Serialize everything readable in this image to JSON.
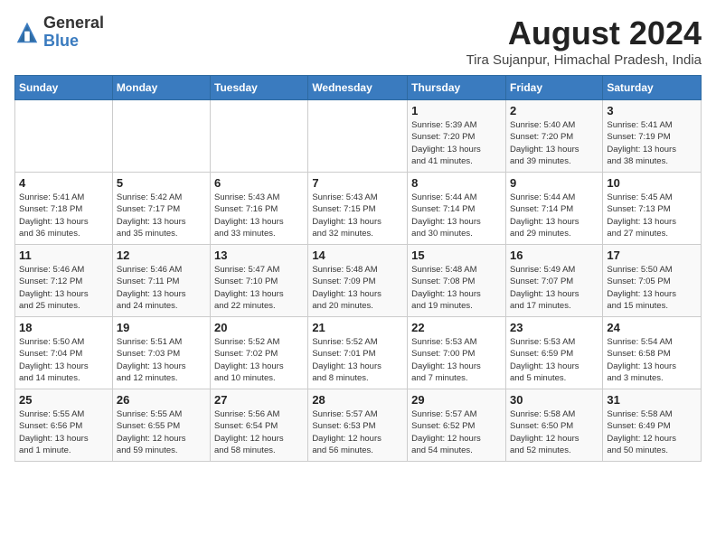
{
  "header": {
    "logo_general": "General",
    "logo_blue": "Blue",
    "month_year": "August 2024",
    "location": "Tira Sujanpur, Himachal Pradesh, India"
  },
  "days_of_week": [
    "Sunday",
    "Monday",
    "Tuesday",
    "Wednesday",
    "Thursday",
    "Friday",
    "Saturday"
  ],
  "weeks": [
    [
      {
        "day": "",
        "info": ""
      },
      {
        "day": "",
        "info": ""
      },
      {
        "day": "",
        "info": ""
      },
      {
        "day": "",
        "info": ""
      },
      {
        "day": "1",
        "info": "Sunrise: 5:39 AM\nSunset: 7:20 PM\nDaylight: 13 hours\nand 41 minutes."
      },
      {
        "day": "2",
        "info": "Sunrise: 5:40 AM\nSunset: 7:20 PM\nDaylight: 13 hours\nand 39 minutes."
      },
      {
        "day": "3",
        "info": "Sunrise: 5:41 AM\nSunset: 7:19 PM\nDaylight: 13 hours\nand 38 minutes."
      }
    ],
    [
      {
        "day": "4",
        "info": "Sunrise: 5:41 AM\nSunset: 7:18 PM\nDaylight: 13 hours\nand 36 minutes."
      },
      {
        "day": "5",
        "info": "Sunrise: 5:42 AM\nSunset: 7:17 PM\nDaylight: 13 hours\nand 35 minutes."
      },
      {
        "day": "6",
        "info": "Sunrise: 5:43 AM\nSunset: 7:16 PM\nDaylight: 13 hours\nand 33 minutes."
      },
      {
        "day": "7",
        "info": "Sunrise: 5:43 AM\nSunset: 7:15 PM\nDaylight: 13 hours\nand 32 minutes."
      },
      {
        "day": "8",
        "info": "Sunrise: 5:44 AM\nSunset: 7:14 PM\nDaylight: 13 hours\nand 30 minutes."
      },
      {
        "day": "9",
        "info": "Sunrise: 5:44 AM\nSunset: 7:14 PM\nDaylight: 13 hours\nand 29 minutes."
      },
      {
        "day": "10",
        "info": "Sunrise: 5:45 AM\nSunset: 7:13 PM\nDaylight: 13 hours\nand 27 minutes."
      }
    ],
    [
      {
        "day": "11",
        "info": "Sunrise: 5:46 AM\nSunset: 7:12 PM\nDaylight: 13 hours\nand 25 minutes."
      },
      {
        "day": "12",
        "info": "Sunrise: 5:46 AM\nSunset: 7:11 PM\nDaylight: 13 hours\nand 24 minutes."
      },
      {
        "day": "13",
        "info": "Sunrise: 5:47 AM\nSunset: 7:10 PM\nDaylight: 13 hours\nand 22 minutes."
      },
      {
        "day": "14",
        "info": "Sunrise: 5:48 AM\nSunset: 7:09 PM\nDaylight: 13 hours\nand 20 minutes."
      },
      {
        "day": "15",
        "info": "Sunrise: 5:48 AM\nSunset: 7:08 PM\nDaylight: 13 hours\nand 19 minutes."
      },
      {
        "day": "16",
        "info": "Sunrise: 5:49 AM\nSunset: 7:07 PM\nDaylight: 13 hours\nand 17 minutes."
      },
      {
        "day": "17",
        "info": "Sunrise: 5:50 AM\nSunset: 7:05 PM\nDaylight: 13 hours\nand 15 minutes."
      }
    ],
    [
      {
        "day": "18",
        "info": "Sunrise: 5:50 AM\nSunset: 7:04 PM\nDaylight: 13 hours\nand 14 minutes."
      },
      {
        "day": "19",
        "info": "Sunrise: 5:51 AM\nSunset: 7:03 PM\nDaylight: 13 hours\nand 12 minutes."
      },
      {
        "day": "20",
        "info": "Sunrise: 5:52 AM\nSunset: 7:02 PM\nDaylight: 13 hours\nand 10 minutes."
      },
      {
        "day": "21",
        "info": "Sunrise: 5:52 AM\nSunset: 7:01 PM\nDaylight: 13 hours\nand 8 minutes."
      },
      {
        "day": "22",
        "info": "Sunrise: 5:53 AM\nSunset: 7:00 PM\nDaylight: 13 hours\nand 7 minutes."
      },
      {
        "day": "23",
        "info": "Sunrise: 5:53 AM\nSunset: 6:59 PM\nDaylight: 13 hours\nand 5 minutes."
      },
      {
        "day": "24",
        "info": "Sunrise: 5:54 AM\nSunset: 6:58 PM\nDaylight: 13 hours\nand 3 minutes."
      }
    ],
    [
      {
        "day": "25",
        "info": "Sunrise: 5:55 AM\nSunset: 6:56 PM\nDaylight: 13 hours\nand 1 minute."
      },
      {
        "day": "26",
        "info": "Sunrise: 5:55 AM\nSunset: 6:55 PM\nDaylight: 12 hours\nand 59 minutes."
      },
      {
        "day": "27",
        "info": "Sunrise: 5:56 AM\nSunset: 6:54 PM\nDaylight: 12 hours\nand 58 minutes."
      },
      {
        "day": "28",
        "info": "Sunrise: 5:57 AM\nSunset: 6:53 PM\nDaylight: 12 hours\nand 56 minutes."
      },
      {
        "day": "29",
        "info": "Sunrise: 5:57 AM\nSunset: 6:52 PM\nDaylight: 12 hours\nand 54 minutes."
      },
      {
        "day": "30",
        "info": "Sunrise: 5:58 AM\nSunset: 6:50 PM\nDaylight: 12 hours\nand 52 minutes."
      },
      {
        "day": "31",
        "info": "Sunrise: 5:58 AM\nSunset: 6:49 PM\nDaylight: 12 hours\nand 50 minutes."
      }
    ]
  ]
}
